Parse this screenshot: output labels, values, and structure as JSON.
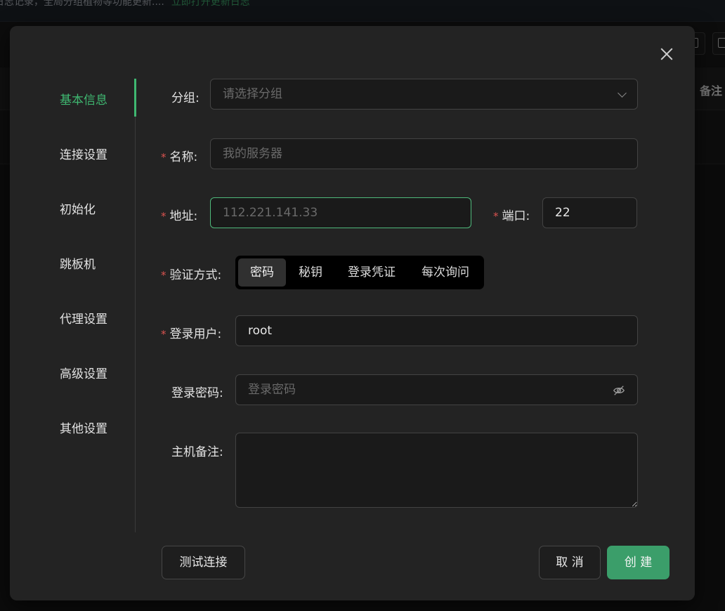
{
  "background": {
    "banner_text": "日志记录，全局分组植物等功能更新....",
    "banner_link": "立即打开更新日志",
    "column_note": "备注"
  },
  "modal": {
    "nav": [
      "基本信息",
      "连接设置",
      "初始化",
      "跳板机",
      "代理设置",
      "高级设置",
      "其他设置"
    ],
    "active_nav": "基本信息",
    "form": {
      "group_label": "分组:",
      "group_placeholder": "请选择分组",
      "name_label": "名称:",
      "name_placeholder": "我的服务器",
      "address_label": "地址:",
      "address_placeholder": "112.221.141.33",
      "port_label": "端口:",
      "port_value": "22",
      "auth_label": "验证方式:",
      "auth_options": [
        "密码",
        "秘钥",
        "登录凭证",
        "每次询问"
      ],
      "auth_selected": "密码",
      "user_label": "登录用户:",
      "user_value": "root",
      "password_label": "登录密码:",
      "password_placeholder": "登录密码",
      "note_label": "主机备注:",
      "required_mark": "*"
    },
    "buttons": {
      "test": "测试连接",
      "cancel": "取 消",
      "create": "创 建"
    }
  },
  "colors": {
    "accent": "#3b9e6a",
    "active_text": "#3fb871",
    "required": "#d9534f"
  }
}
